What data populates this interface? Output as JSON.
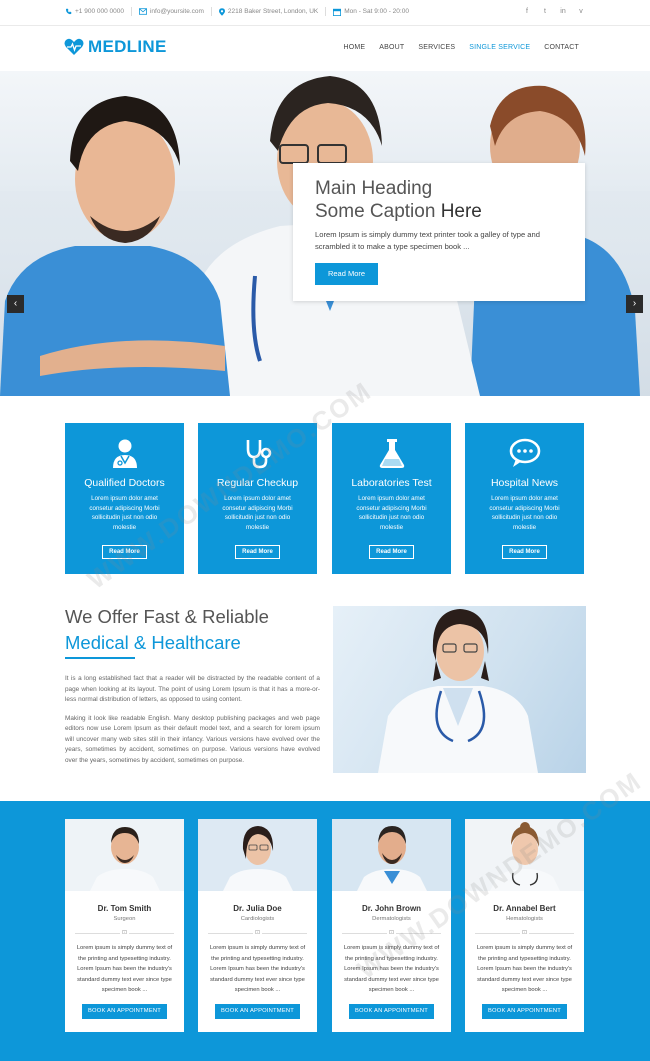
{
  "topbar": {
    "phone": "+1 900 000 0000",
    "email": "info@yoursite.com",
    "address": "2218 Baker Street, London, UK",
    "hours": "Mon - Sat 9:00 - 20:00",
    "social": [
      "f",
      "t",
      "in",
      "v"
    ]
  },
  "header": {
    "logo_text": "MEDLINE",
    "nav": [
      "HOME",
      "ABOUT",
      "SERVICES",
      "SINGLE SERVICE",
      "CONTACT"
    ],
    "active_nav": "SINGLE SERVICE"
  },
  "hero": {
    "heading_line1": "Main Heading",
    "heading_line2_pre": "Some Caption",
    "heading_line2_bold": "Here",
    "text": "Lorem Ipsum is simply dummy text printer took a galley of type and scrambled it to make a type specimen book ...",
    "button": "Read More",
    "prev_arrow": "‹",
    "next_arrow": "›"
  },
  "services": [
    {
      "icon": "doctor-icon",
      "title": "Qualified Doctors",
      "desc": "Lorem ipsum dolor amet consetur adipiscing Morbi sollicitudin just non odio molestie",
      "button": "Read More"
    },
    {
      "icon": "stethoscope-icon",
      "title": "Regular Checkup",
      "desc": "Lorem ipsum dolor amet consetur adipiscing Morbi sollicitudin just non odio molestie",
      "button": "Read More"
    },
    {
      "icon": "flask-icon",
      "title": "Laboratories Test",
      "desc": "Lorem ipsum dolor amet consetur adipiscing Morbi sollicitudin just non odio molestie",
      "button": "Read More"
    },
    {
      "icon": "chat-icon",
      "title": "Hospital News",
      "desc": "Lorem ipsum dolor amet consetur adipiscing Morbi sollicitudin just non odio molestie",
      "button": "Read More"
    }
  ],
  "about": {
    "title_line1": "We Offer Fast & Reliable",
    "title_line2": "Medical & Healthcare",
    "para1": "It is a long established fact that a reader will be distracted by the readable content of a page when looking at its layout. The point of using Lorem Ipsum is that it has a more-or-less normal distribution of letters, as opposed to using content.",
    "para2": "Making it look like readable English. Many desktop publishing packages and web page editors now use Lorem Ipsum as their default model text, and a search for lorem ipsum will uncover many web sites still in their infancy. Various versions have evolved over the years, sometimes by accident, sometimes on purpose. Various versions have evolved over the years, sometimes by accident, sometimes on purpose."
  },
  "doctors": [
    {
      "name": "Dr. Tom Smith",
      "role": "Surgeon",
      "bio": "Lorem ipsum is simply dummy text of the printing and typesetting industry. Lorem Ipsum has been the industry's standard dummy text ever since type specimen book ...",
      "button": "BOOK AN APPOINTMENT"
    },
    {
      "name": "Dr. Julia Doe",
      "role": "Cardiologists",
      "bio": "Lorem ipsum is simply dummy text of the printing and typesetting industry. Lorem Ipsum has been the industry's standard dummy text ever since type specimen book ...",
      "button": "BOOK AN APPOINTMENT"
    },
    {
      "name": "Dr. John Brown",
      "role": "Dermatologists",
      "bio": "Lorem ipsum is simply dummy text of the printing and typesetting industry. Lorem Ipsum has been the industry's standard dummy text ever since type specimen book ...",
      "button": "BOOK AN APPOINTMENT"
    },
    {
      "name": "Dr. Annabel Bert",
      "role": "Hematologists",
      "bio": "Lorem ipsum is simply dummy text of the printing and typesetting industry. Lorem Ipsum has been the industry's standard dummy text ever since type specimen book ...",
      "button": "BOOK AN APPOINTMENT"
    }
  ],
  "watermark": "WWW.DOWNDEMO.COM",
  "colors": {
    "accent": "#0d97d9",
    "scrubs": "#3a8fd6",
    "dark": "#2b2b2b"
  }
}
